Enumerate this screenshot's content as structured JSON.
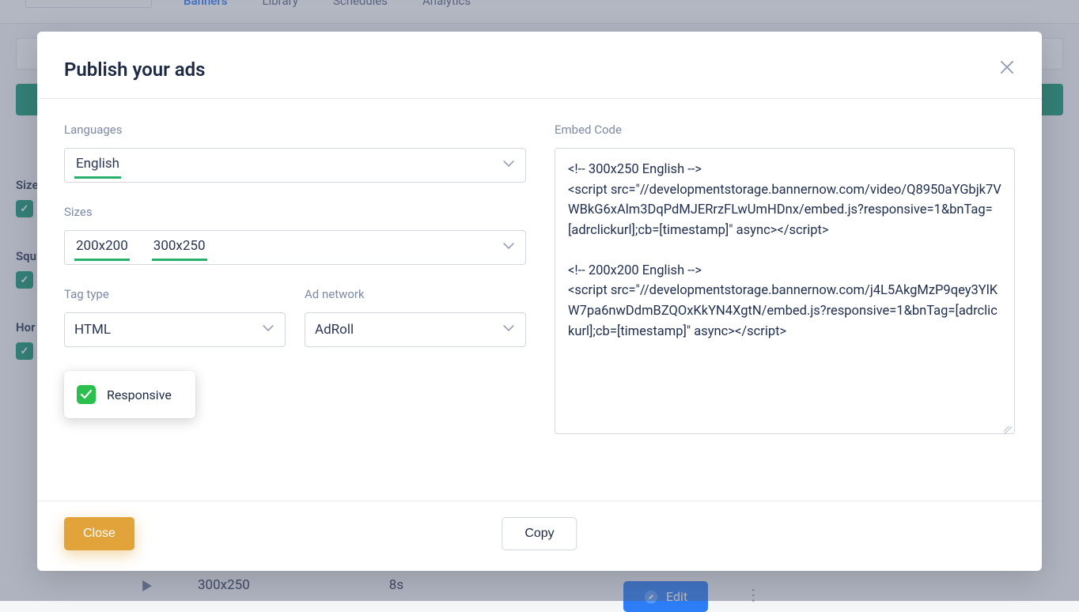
{
  "nav": {
    "items": [
      "Banners",
      "Library",
      "Schedules",
      "Analytics"
    ],
    "active_index": 0
  },
  "sidebar": {
    "groups": [
      {
        "label": "Size"
      },
      {
        "label": "Squ"
      },
      {
        "label": "Hor"
      }
    ]
  },
  "bg_row": {
    "size": "300x250",
    "duration": "8s",
    "edit_label": "Edit"
  },
  "modal": {
    "title": "Publish your ads",
    "close_label": "Close",
    "copy_label": "Copy",
    "languages": {
      "label": "Languages",
      "selected": [
        "English"
      ]
    },
    "sizes": {
      "label": "Sizes",
      "selected": [
        "200x200",
        "300x250"
      ]
    },
    "tag_type": {
      "label": "Tag type",
      "value": "HTML"
    },
    "ad_network": {
      "label": "Ad network",
      "value": "AdRoll"
    },
    "responsive": {
      "label": "Responsive",
      "checked": true
    },
    "embed": {
      "label": "Embed Code",
      "value": "<!-- 300x250 English -->\n<script src=\"//developmentstorage.bannernow.com/video/Q8950aYGbjk7VWBkG6xAlm3DqPdMJERrzFLwUmHDnx/embed.js?responsive=1&bnTag=[adrclickurl];cb=[timestamp]\" async></script>\n\n<!-- 200x200 English -->\n<script src=\"//developmentstorage.bannernow.com/j4L5AkgMzP9qey3YlKW7pa6nwDdmBZQOxKkYN4XgtN/embed.js?responsive=1&bnTag=[adrclickurl];cb=[timestamp]\" async></script>"
    }
  }
}
